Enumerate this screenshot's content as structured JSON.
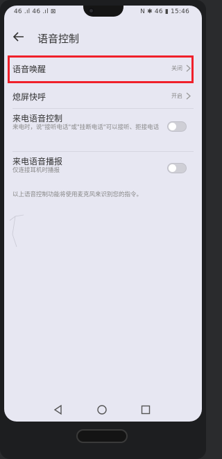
{
  "status_bar": {
    "left_text": "46 .ıl 46 .ıl ⊠",
    "right_text": "N ✱ 46 ▮ 15:46"
  },
  "header": {
    "title": "语音控制"
  },
  "settings": {
    "voice_wake": {
      "label": "语音唤醒",
      "value": "关闭"
    },
    "screen_off_quick": {
      "label": "熄屏快呼",
      "value": "开启"
    },
    "incoming_call_voice_control": {
      "label": "来电语音控制",
      "description": "来电时，说\"接听电话\"或\"挂断电话\"可以接听、拒接电话",
      "enabled": false
    },
    "incoming_call_voice_broadcast": {
      "label": "来电语音播报",
      "description": "仅连接耳机时播报",
      "enabled": false
    },
    "footnote": "以上语音控制功能将使用麦克风来识别您的指令。"
  },
  "colors": {
    "highlight": "#f0202a",
    "background": "#e7e7f2"
  }
}
